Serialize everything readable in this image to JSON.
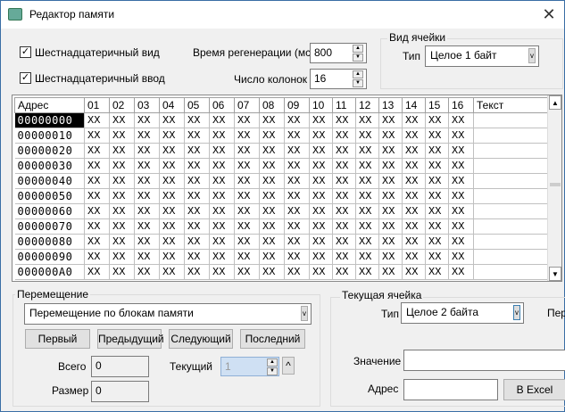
{
  "window": {
    "title": "Редактор памяти",
    "close": "✕"
  },
  "options": {
    "hex_view": {
      "label": "Шестнадцатеричный вид",
      "checked": true
    },
    "hex_input": {
      "label": "Шестнадцатеричный ввод",
      "checked": true
    },
    "refresh_label": "Время регенерации (мс)",
    "refresh_value": "800",
    "columns_label": "Число колонок",
    "columns_value": "16"
  },
  "cell_view": {
    "title": "Вид ячейки",
    "type_label": "Тип",
    "type_value": "Целое 1 байт"
  },
  "grid": {
    "headers": [
      "Адрес",
      "01",
      "02",
      "03",
      "04",
      "05",
      "06",
      "07",
      "08",
      "09",
      "10",
      "11",
      "12",
      "13",
      "14",
      "15",
      "16",
      "Текст"
    ],
    "rows": [
      "00000000",
      "00000010",
      "00000020",
      "00000030",
      "00000040",
      "00000050",
      "00000060",
      "00000070",
      "00000080",
      "00000090",
      "000000A0"
    ],
    "cell": "XX",
    "selected_row": 0
  },
  "navigation": {
    "title": "Перемещение",
    "mode": "Перемещение по блокам памяти",
    "buttons": [
      "Первый",
      "Предыдущий",
      "Следующий",
      "Последний"
    ],
    "total_label": "Всего",
    "total_value": "0",
    "size_label": "Размер",
    "size_value": "0",
    "current_label": "Текущий",
    "current_value": "1",
    "up": "^"
  },
  "current_cell": {
    "title": "Текущая ячейка",
    "type_label": "Тип",
    "type_value": "Целое 2 байта",
    "cut_label": "Пер",
    "value_label": "Значение",
    "value": "",
    "address_label": "Адрес",
    "address": "",
    "excel_button": "В Excel"
  }
}
